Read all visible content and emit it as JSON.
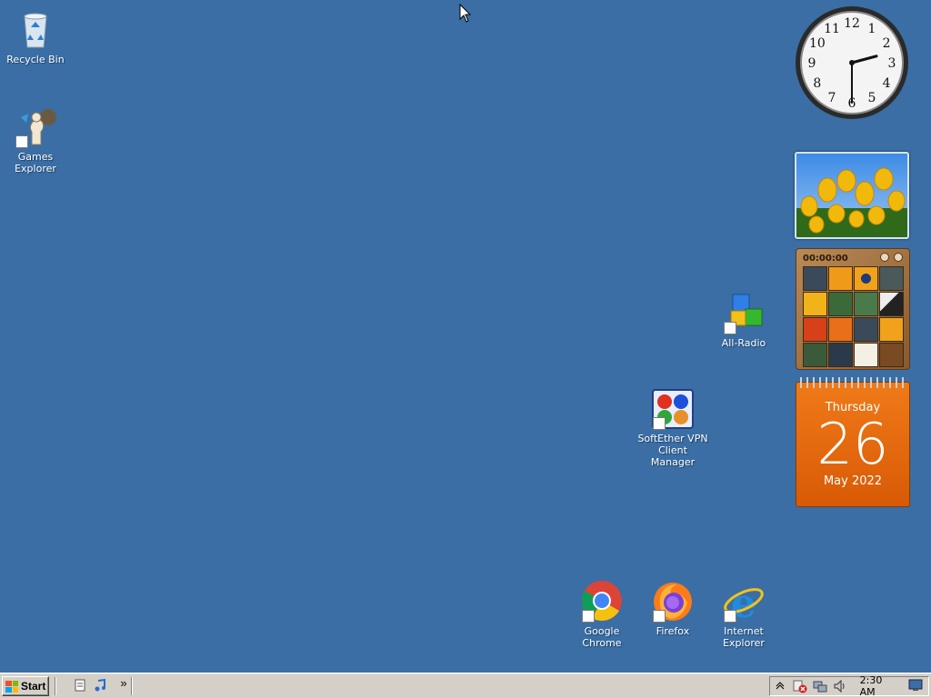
{
  "desktop_icons": {
    "recycle_bin": "Recycle Bin",
    "games_explorer": "Games Explorer",
    "all_radio": "All-Radio",
    "softether": "SoftEther VPN Client Manager",
    "chrome": "Google Chrome",
    "firefox": "Firefox",
    "ie": "Internet Explorer"
  },
  "gadgets": {
    "clock": {
      "numbers": [
        "12",
        "1",
        "2",
        "3",
        "4",
        "5",
        "6",
        "7",
        "8",
        "9",
        "10",
        "11"
      ],
      "hour": 2,
      "minute": 30
    },
    "puzzle": {
      "timer": "00:00:00"
    },
    "calendar": {
      "weekday": "Thursday",
      "day": "26",
      "month_year": "May 2022"
    }
  },
  "taskbar": {
    "start_label": "Start",
    "overflow": "»",
    "clock": "2:30 AM"
  },
  "colors": {
    "desktop": "#3a6ea5",
    "taskbar": "#d4d0c8",
    "calendar": "#e8680c"
  }
}
